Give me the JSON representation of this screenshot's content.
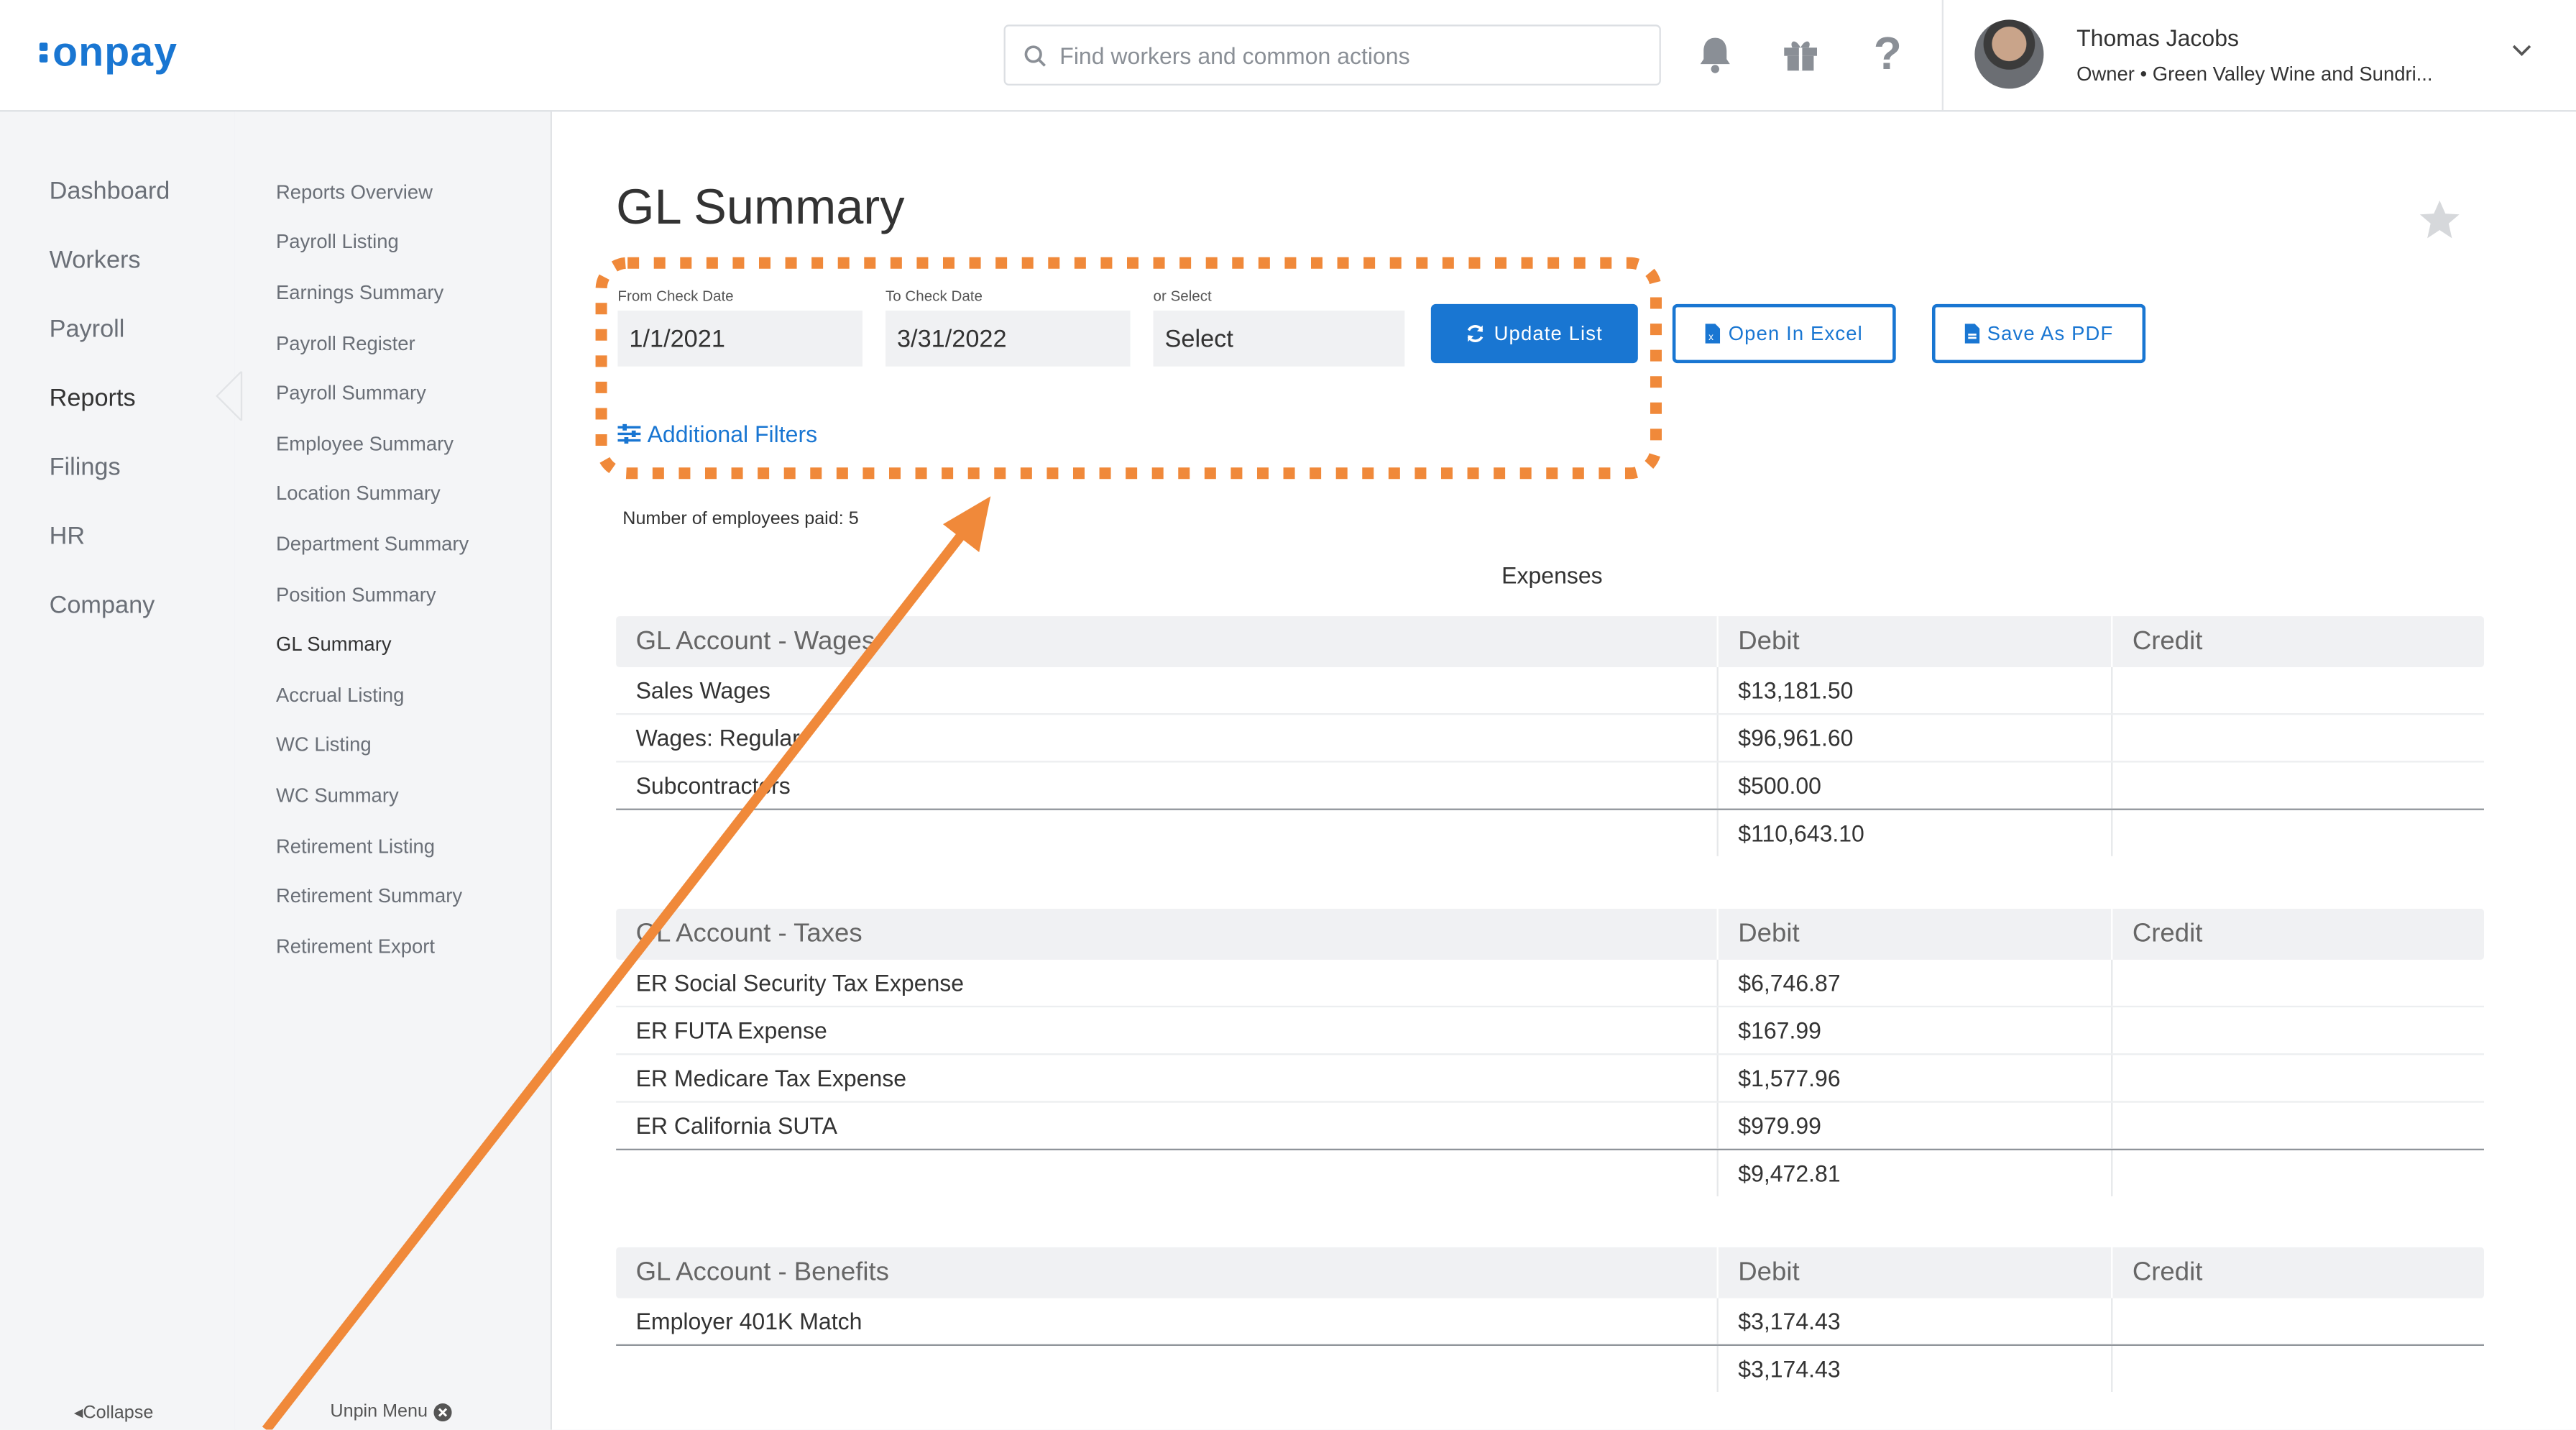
{
  "logo": "onpay",
  "search": {
    "placeholder": "Find workers and common actions"
  },
  "user": {
    "name": "Thomas Jacobs",
    "role": "Owner • Green Valley Wine and Sundri..."
  },
  "nav": {
    "items": [
      "Dashboard",
      "Workers",
      "Payroll",
      "Reports",
      "Filings",
      "HR",
      "Company"
    ],
    "active": "Reports",
    "collapse": "Collapse"
  },
  "subnav": {
    "items": [
      "Reports Overview",
      "Payroll Listing",
      "Earnings Summary",
      "Payroll Register",
      "Payroll Summary",
      "Employee Summary",
      "Location Summary",
      "Department Summary",
      "Position Summary",
      "GL Summary",
      "Accrual Listing",
      "WC Listing",
      "WC Summary",
      "Retirement Listing",
      "Retirement Summary",
      "Retirement Export"
    ],
    "active": "GL Summary",
    "unpin": "Unpin Menu"
  },
  "page": {
    "title": "GL Summary",
    "from_label": "From Check Date",
    "from_value": "1/1/2021",
    "to_label": "To Check Date",
    "to_value": "3/31/2022",
    "select_label": "or Select",
    "select_value": "Select",
    "update_button": "Update List",
    "excel_button": "Open In Excel",
    "pdf_button": "Save As PDF",
    "additional_filters": "Additional Filters",
    "employees_paid": "Number of employees paid: 5",
    "section_title": "Expenses"
  },
  "tables": [
    {
      "header": "GL Account - Wages",
      "debit_header": "Debit",
      "credit_header": "Credit",
      "rows": [
        {
          "account": "Sales Wages",
          "debit": "$13,181.50",
          "credit": ""
        },
        {
          "account": "Wages: Regular",
          "debit": "$96,961.60",
          "credit": ""
        },
        {
          "account": "Subcontractors",
          "debit": "$500.00",
          "credit": ""
        }
      ],
      "total_debit": "$110,643.10"
    },
    {
      "header": "GL Account - Taxes",
      "debit_header": "Debit",
      "credit_header": "Credit",
      "rows": [
        {
          "account": "ER Social Security Tax Expense",
          "debit": "$6,746.87",
          "credit": ""
        },
        {
          "account": "ER FUTA Expense",
          "debit": "$167.99",
          "credit": ""
        },
        {
          "account": "ER Medicare Tax Expense",
          "debit": "$1,577.96",
          "credit": ""
        },
        {
          "account": "ER California SUTA",
          "debit": "$979.99",
          "credit": ""
        }
      ],
      "total_debit": "$9,472.81"
    },
    {
      "header": "GL Account - Benefits",
      "debit_header": "Debit",
      "credit_header": "Credit",
      "rows": [
        {
          "account": "Employer 401K Match",
          "debit": "$3,174.43",
          "credit": ""
        }
      ],
      "total_debit": "$3,174.43"
    }
  ],
  "colors": {
    "brand": "#1976d2",
    "annotation": "#f0893a"
  }
}
